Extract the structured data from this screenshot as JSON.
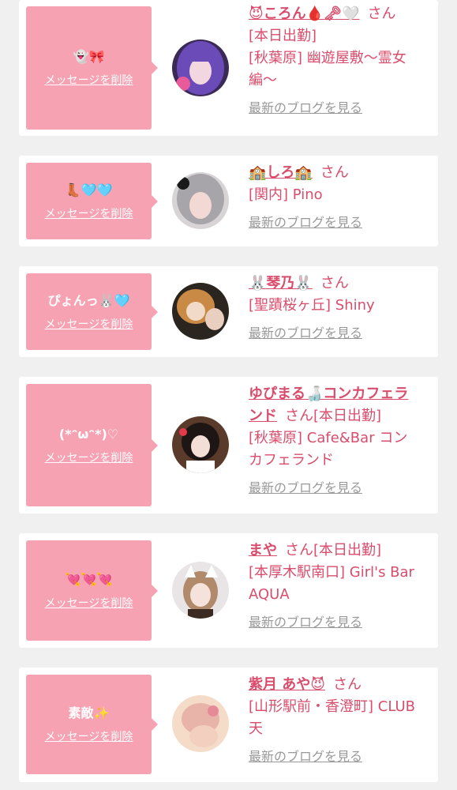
{
  "cards": [
    {
      "message": "👻🎀",
      "delete_label": "メッセージを削除",
      "name": "😈ころん🩸🗝🤍",
      "san": "さん",
      "status": "",
      "location_line1": "[本日出勤]",
      "location_line2": "[秋葉原] 幽遊屋敷〜霊女",
      "location_line3": "編〜",
      "blog_label": "最新のブログを見る",
      "avatar_icon": "purple-hair-avatar"
    },
    {
      "message": "👢🩵🩵",
      "delete_label": "メッセージを削除",
      "name": "🏫しろ🏫",
      "san": "さん",
      "location_line1": "[関内] Pino",
      "blog_label": "最新のブログを見る",
      "avatar_icon": "silver-hair-avatar"
    },
    {
      "message": "ぴょんっ🐰🩵",
      "delete_label": "メッセージを削除",
      "name": "🐰琴乃🐰",
      "san": "さん",
      "location_line1": "[聖蹟桜ヶ丘] Shiny",
      "blog_label": "最新のブログを見る",
      "avatar_icon": "animal-hood-avatar"
    },
    {
      "message": "(*ᵔωᵔ*)♡",
      "delete_label": "メッセージを削除",
      "name_line1": "ゆぴまる🍶コンカフェラ",
      "name_line2": "ンド",
      "san": "さん",
      "status": "[本日出勤]",
      "location_line1": "[秋葉原] Cafe&Bar コン",
      "location_line2": "カフェランド",
      "blog_label": "最新のブログを見る",
      "avatar_icon": "maid-avatar"
    },
    {
      "message": "💘💘💘",
      "delete_label": "メッセージを削除",
      "name": "まや",
      "san": "さん",
      "status": "[本日出勤]",
      "location_line1": "[本厚木駅南口] Girl's Bar",
      "location_line2": "AQUA",
      "blog_label": "最新のブログを見る",
      "avatar_icon": "cat-ear-avatar"
    },
    {
      "message": "素敵✨",
      "delete_label": "メッセージを削除",
      "name": "紫月 あや😈",
      "san": "さん",
      "location_line1": "[山形駅前・香澄町] CLUB",
      "location_line2": "天",
      "blog_label": "最新のブログを見る",
      "avatar_icon": "pink-blur-avatar"
    }
  ],
  "colors": {
    "message_bg": "#f7a2b2",
    "accent_text": "#d94d6c",
    "blog_link": "#999999",
    "page_bg": "#f0f0f0"
  }
}
